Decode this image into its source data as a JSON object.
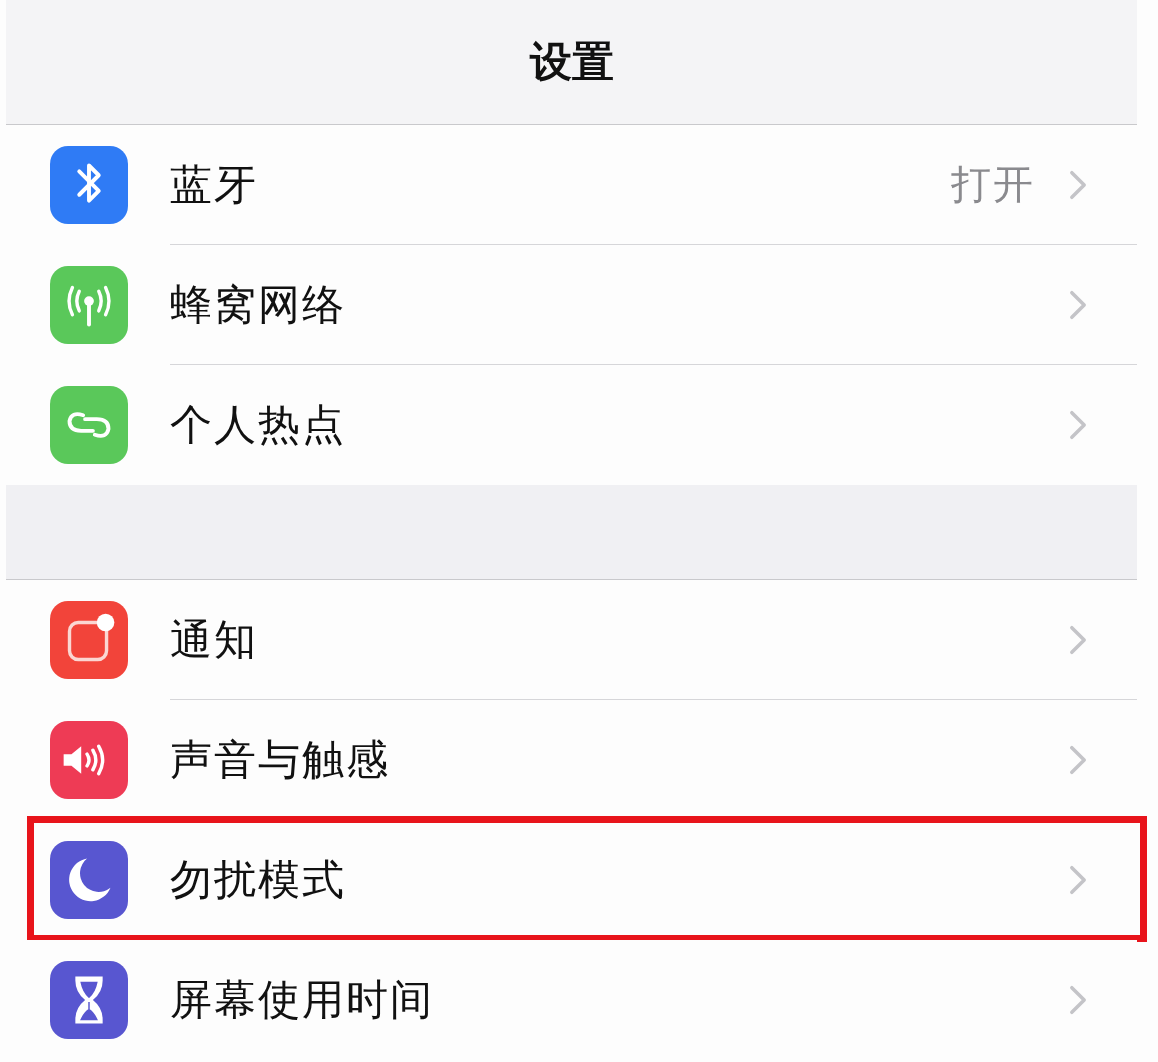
{
  "nav": {
    "title": "设置"
  },
  "groups": [
    {
      "items": [
        {
          "kind": "bluetooth",
          "color": "#2f7bf5",
          "label": "蓝牙",
          "value": "打开",
          "highlighted": false
        },
        {
          "kind": "cellular",
          "color": "#5ac85a",
          "label": "蜂窝网络",
          "highlighted": false
        },
        {
          "kind": "hotspot",
          "color": "#5ac85a",
          "label": "个人热点",
          "highlighted": false
        }
      ]
    },
    {
      "items": [
        {
          "kind": "notifications",
          "color": "#f2443a",
          "label": "通知",
          "highlighted": false
        },
        {
          "kind": "sound",
          "color": "#ee3b55",
          "label": "声音与触感",
          "highlighted": false
        },
        {
          "kind": "moon",
          "color": "#5856d0",
          "label": "勿扰模式",
          "highlighted": true
        },
        {
          "kind": "hourglass",
          "color": "#5856d0",
          "label": "屏幕使用时间",
          "highlighted": false
        }
      ]
    }
  ]
}
